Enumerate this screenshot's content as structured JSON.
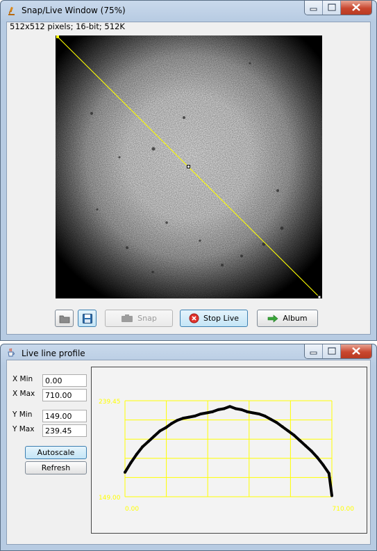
{
  "snap_window": {
    "title": "Snap/Live Window (75%)",
    "image_info": "512x512 pixels; 16-bit; 512K",
    "buttons": {
      "open_icon": "folder-icon",
      "save_icon": "save-disk-icon",
      "snap_label": "Snap",
      "stop_live_label": "Stop Live",
      "album_label": "Album"
    },
    "line_selection_color": "#ffff00"
  },
  "profile_window": {
    "title": "Live line profile",
    "x_min_label": "X Min",
    "x_min_value": "0.00",
    "x_max_label": "X Max",
    "x_max_value": "710.00",
    "y_min_label": "Y Min",
    "y_min_value": "149.00",
    "y_max_label": "Y Max",
    "y_max_value": "239.45",
    "autoscale_label": "Autoscale",
    "refresh_label": "Refresh"
  },
  "chart_data": {
    "type": "line",
    "title": "",
    "xlabel": "",
    "ylabel": "",
    "xlim": [
      0,
      710
    ],
    "ylim": [
      149,
      239.45
    ],
    "x_tick_labels": [
      "0.00",
      "710.00"
    ],
    "y_tick_labels": [
      "149.00",
      "239.45"
    ],
    "grid": true,
    "grid_color": "#ffff00",
    "line_color": "#000000",
    "series": [
      {
        "x": [
          0,
          20,
          40,
          60,
          80,
          100,
          120,
          140,
          160,
          180,
          200,
          220,
          240,
          260,
          280,
          300,
          320,
          340,
          360,
          380,
          400,
          420,
          440,
          460,
          480,
          500,
          520,
          540,
          560,
          580,
          600,
          620,
          640,
          660,
          680,
          700,
          710
        ],
        "y": [
          172,
          181,
          189,
          196,
          201,
          206,
          211,
          214,
          218,
          221,
          223,
          224,
          225,
          227,
          228,
          229,
          231,
          232,
          234,
          232,
          231,
          229,
          228,
          227,
          225,
          222,
          219,
          215,
          211,
          207,
          202,
          197,
          192,
          186,
          179,
          171,
          150
        ]
      }
    ]
  }
}
